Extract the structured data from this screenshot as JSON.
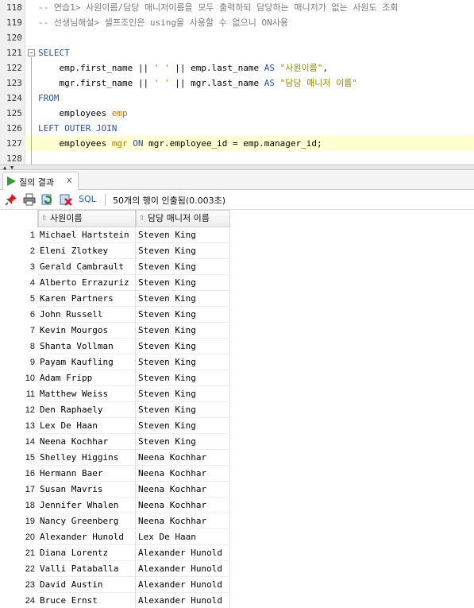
{
  "editor": {
    "lines": [
      {
        "num": "118",
        "tokens": [
          {
            "t": "-- 연습1> 사원이름/담당 매니저이름을 모두 출력하되 담당하는 매니저가 없는 사원도 조회",
            "c": "cm"
          }
        ]
      },
      {
        "num": "119",
        "tokens": [
          {
            "t": "-- 선생님해설> 셀프조인은 using을 사용할 수 없으니 ON사용",
            "c": "cm"
          }
        ]
      },
      {
        "num": "120",
        "tokens": []
      },
      {
        "num": "121",
        "tokens": [
          {
            "t": "SELECT",
            "c": "kw"
          }
        ]
      },
      {
        "num": "122",
        "tokens": [
          {
            "t": "    emp.first_name || ",
            "c": "id"
          },
          {
            "t": "' '",
            "c": "str"
          },
          {
            "t": " || emp.last_name ",
            "c": "id"
          },
          {
            "t": "AS",
            "c": "kw"
          },
          {
            "t": " ",
            "c": "id"
          },
          {
            "t": "\"사원이름\"",
            "c": "str"
          },
          {
            "t": ",",
            "c": "id"
          }
        ]
      },
      {
        "num": "123",
        "tokens": [
          {
            "t": "    mgr.first_name || ",
            "c": "id"
          },
          {
            "t": "' '",
            "c": "str"
          },
          {
            "t": " || mgr.last_name ",
            "c": "id"
          },
          {
            "t": "AS",
            "c": "kw"
          },
          {
            "t": " ",
            "c": "id"
          },
          {
            "t": "\"담당 매니저 이름\"",
            "c": "str"
          }
        ]
      },
      {
        "num": "124",
        "tokens": [
          {
            "t": "FROM",
            "c": "kw"
          }
        ]
      },
      {
        "num": "125",
        "tokens": [
          {
            "t": "    employees ",
            "c": "id"
          },
          {
            "t": "emp",
            "c": "al"
          }
        ]
      },
      {
        "num": "126",
        "tokens": [
          {
            "t": "LEFT OUTER JOIN",
            "c": "kw"
          }
        ]
      },
      {
        "num": "127",
        "tokens": [
          {
            "t": "    employees ",
            "c": "id"
          },
          {
            "t": "mgr",
            "c": "al"
          },
          {
            "t": " ",
            "c": "id"
          },
          {
            "t": "ON",
            "c": "kw"
          },
          {
            "t": " mgr.employee_id = emp.manager_id;",
            "c": "id"
          }
        ]
      },
      {
        "num": "128",
        "tokens": []
      }
    ],
    "current_line": "127",
    "fold_line": "121"
  },
  "results_tab": {
    "label": "질의 결과",
    "close": "x"
  },
  "toolbar": {
    "pin_icon": "pin-icon",
    "print_icon": "print-icon",
    "refresh_icon": "refresh-icon",
    "delete_icon": "delete-icon",
    "sql_label": "SQL",
    "status": "50개의 행이 인출됨(0.003초)"
  },
  "grid": {
    "columns": [
      "사원이름",
      "담당 매니저 이름"
    ],
    "rows": [
      {
        "n": "1",
        "emp": "Michael Hartstein",
        "mgr": "Steven King"
      },
      {
        "n": "2",
        "emp": "Eleni Zlotkey",
        "mgr": "Steven King"
      },
      {
        "n": "3",
        "emp": "Gerald Cambrault",
        "mgr": "Steven King"
      },
      {
        "n": "4",
        "emp": "Alberto Errazuriz",
        "mgr": "Steven King"
      },
      {
        "n": "5",
        "emp": "Karen Partners",
        "mgr": "Steven King"
      },
      {
        "n": "6",
        "emp": "John Russell",
        "mgr": "Steven King"
      },
      {
        "n": "7",
        "emp": "Kevin Mourgos",
        "mgr": "Steven King"
      },
      {
        "n": "8",
        "emp": "Shanta Vollman",
        "mgr": "Steven King"
      },
      {
        "n": "9",
        "emp": "Payam Kaufling",
        "mgr": "Steven King"
      },
      {
        "n": "10",
        "emp": "Adam Fripp",
        "mgr": "Steven King"
      },
      {
        "n": "11",
        "emp": "Matthew Weiss",
        "mgr": "Steven King"
      },
      {
        "n": "12",
        "emp": "Den Raphaely",
        "mgr": "Steven King"
      },
      {
        "n": "13",
        "emp": "Lex De Haan",
        "mgr": "Steven King"
      },
      {
        "n": "14",
        "emp": "Neena Kochhar",
        "mgr": "Steven King"
      },
      {
        "n": "15",
        "emp": "Shelley Higgins",
        "mgr": "Neena Kochhar"
      },
      {
        "n": "16",
        "emp": "Hermann Baer",
        "mgr": "Neena Kochhar"
      },
      {
        "n": "17",
        "emp": "Susan Mavris",
        "mgr": "Neena Kochhar"
      },
      {
        "n": "18",
        "emp": "Jennifer Whalen",
        "mgr": "Neena Kochhar"
      },
      {
        "n": "19",
        "emp": "Nancy Greenberg",
        "mgr": "Neena Kochhar"
      },
      {
        "n": "20",
        "emp": "Alexander Hunold",
        "mgr": "Lex De Haan"
      },
      {
        "n": "21",
        "emp": "Diana Lorentz",
        "mgr": "Alexander Hunold"
      },
      {
        "n": "22",
        "emp": "Valli Pataballa",
        "mgr": "Alexander Hunold"
      },
      {
        "n": "23",
        "emp": "David Austin",
        "mgr": "Alexander Hunold"
      },
      {
        "n": "24",
        "emp": "Bruce Ernst",
        "mgr": "Alexander Hunold"
      }
    ]
  }
}
